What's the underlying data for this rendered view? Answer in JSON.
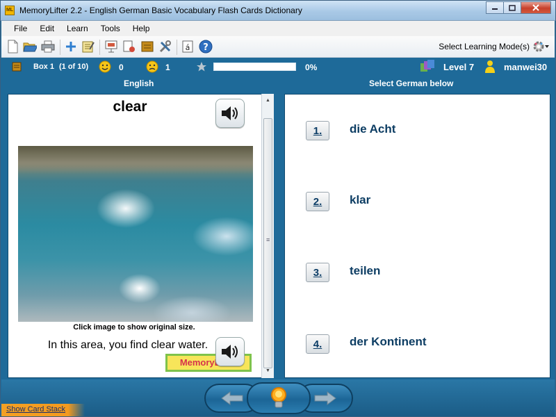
{
  "window": {
    "title": "MemoryLifter 2.2 - English German Basic Vocabulary Flash Cards Dictionary",
    "app_icon_text": "ML"
  },
  "menu": [
    "File",
    "Edit",
    "Learn",
    "Tools",
    "Help"
  ],
  "toolbar": {
    "icons": [
      "new-icon",
      "open-icon",
      "print-icon",
      "add-card-icon",
      "edit-icon",
      "slideshow-icon",
      "card-settings-icon",
      "box-icon",
      "tools-icon",
      "accent-icon",
      "help-icon"
    ],
    "mode_label": "Select Learning Mode(s)"
  },
  "status": {
    "box_label": "Box 1",
    "box_count": "(1 of 10)",
    "correct": "0",
    "wrong": "1",
    "progress": 0,
    "progress_text": "0%",
    "level": "Level 7",
    "user": "manwei30"
  },
  "columns": {
    "left": "English",
    "right": "Select German below"
  },
  "card": {
    "word": "clear",
    "image_caption": "Click image to show original size.",
    "example": "In this area, you find clear water.",
    "logo_text": "MemoryLifter"
  },
  "answers": [
    {
      "num": "1.",
      "text": "die Acht"
    },
    {
      "num": "2.",
      "text": "klar"
    },
    {
      "num": "3.",
      "text": "teilen"
    },
    {
      "num": "4.",
      "text": "der Kontinent"
    }
  ],
  "footer": {
    "show_stack": "Show Card Stack"
  },
  "colors": {
    "frame": "#1e6a99",
    "answer_text": "#0d3d63",
    "stack_tab": "#f39a1e"
  }
}
